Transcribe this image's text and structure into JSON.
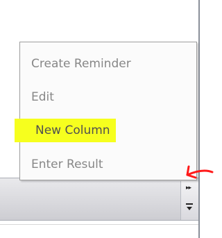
{
  "context_menu": {
    "items": [
      {
        "label": "Create Reminder",
        "highlighted": false
      },
      {
        "label": "Edit",
        "highlighted": false
      },
      {
        "label": "New Column",
        "highlighted": true
      },
      {
        "label": "Enter Result",
        "highlighted": false
      }
    ]
  },
  "toolbar": {
    "overflow_chevron": "»",
    "overflow_icon": "chevron-double-right-icon",
    "customize_icon": "toolbar-customize-icon"
  },
  "annotation": {
    "arrow_icon": "red-handdrawn-arrow-icon",
    "arrow_color": "#ff1a1a",
    "highlight_color": "#f6ff1e"
  },
  "colors": {
    "menu_text": "#878787",
    "menu_background": "#fbfbfb",
    "toolbar_background": "#d6d6da"
  }
}
